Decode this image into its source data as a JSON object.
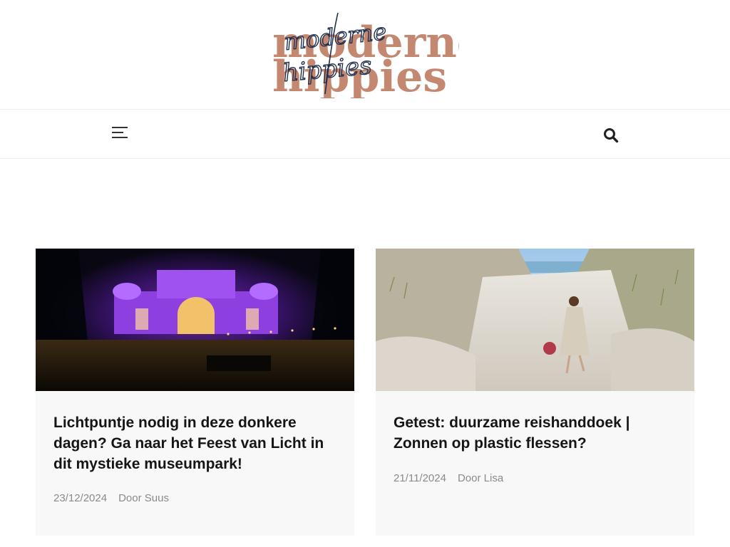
{
  "brand": {
    "logo_main_line1": "moderne",
    "logo_main_line2": "hippies",
    "logo_script_line1": "moderne",
    "logo_script_line2": "hippies"
  },
  "colors": {
    "logo_main": "#c48870",
    "logo_script": "#1f2e4d",
    "title": "#151515",
    "meta": "#8a8a8a",
    "card_bg": "#f8f8f8"
  },
  "nav": {
    "menu_icon": "hamburger-menu-icon",
    "search_icon": "search-icon"
  },
  "posts": [
    {
      "title": "Lichtpuntje nodig in deze donkere dagen? Ga naar het Feest van Licht in dit mystieke museumpark!",
      "date": "23/12/2024",
      "author": "Door Suus",
      "image": "illuminated-museum-at-night"
    },
    {
      "title": "Getest: duurzame reishanddoek | Zonnen op plastic flessen?",
      "date": "21/11/2024",
      "author": "Door Lisa",
      "image": "woman-walking-through-dunes"
    }
  ]
}
